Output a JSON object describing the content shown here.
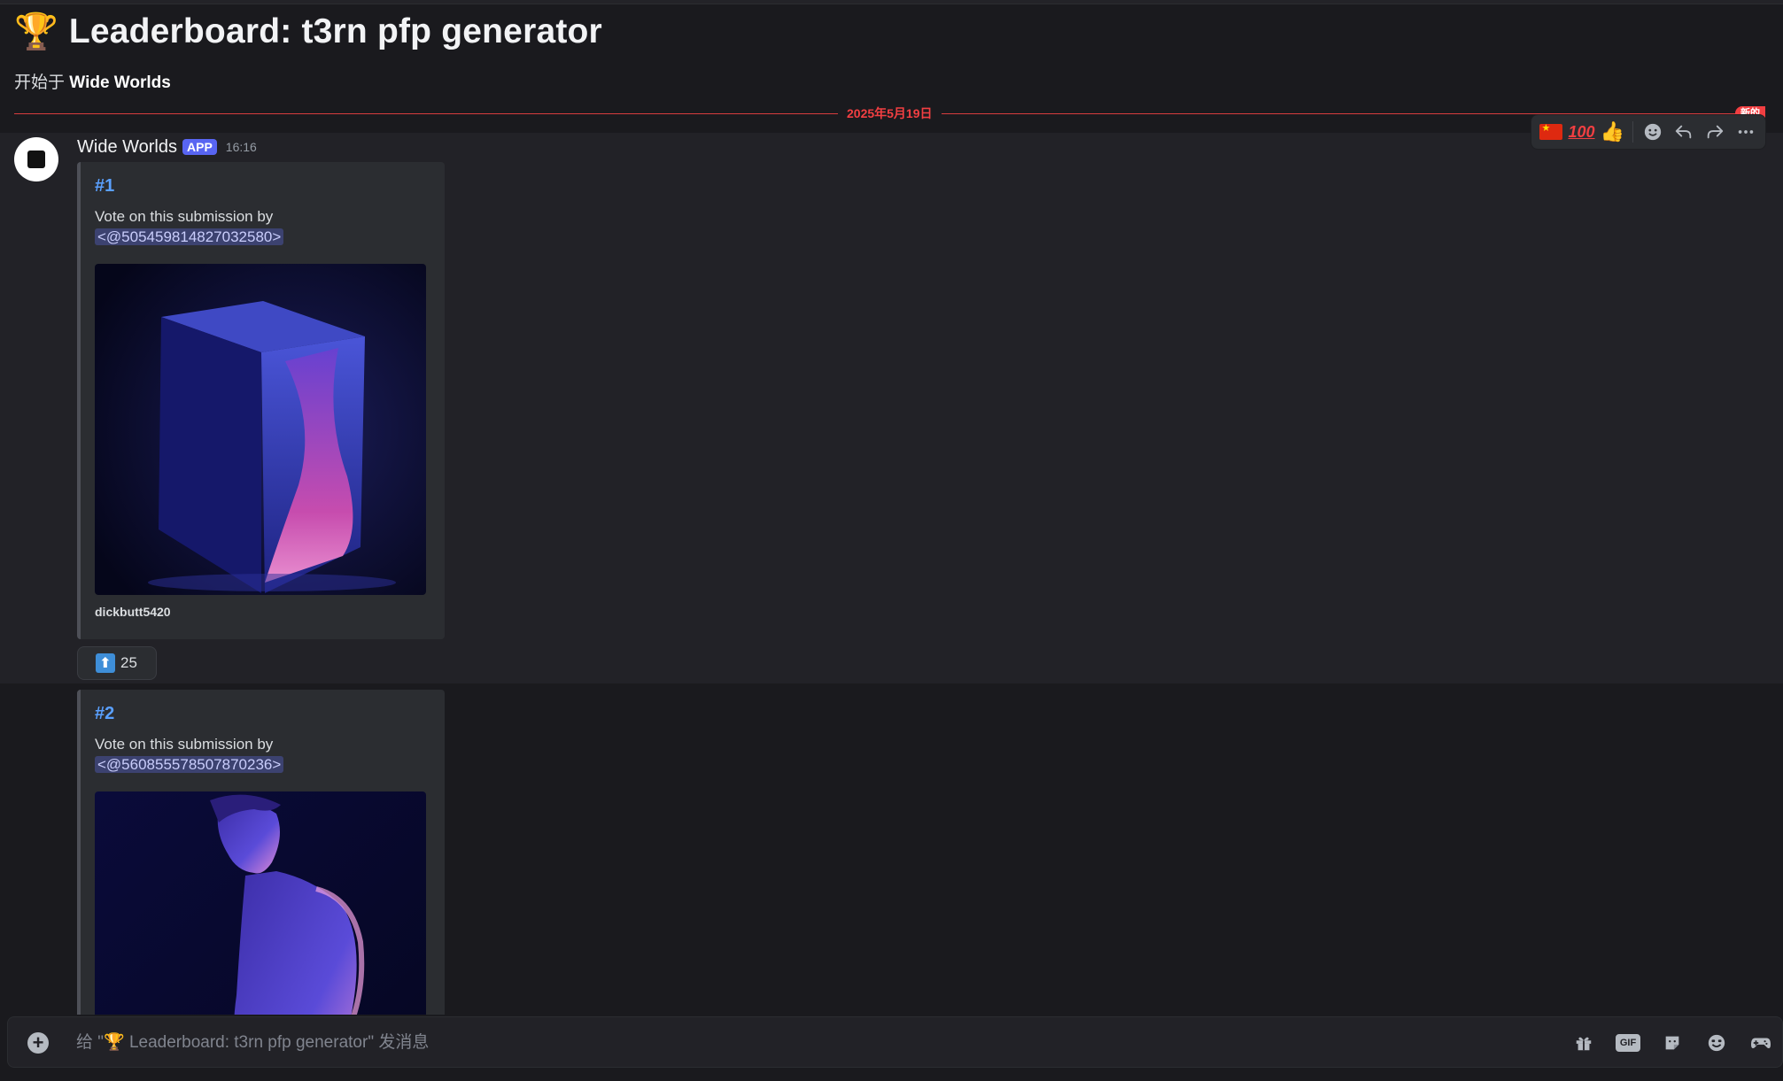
{
  "channel": {
    "icon": "trophy-icon",
    "emoji": "🏆",
    "title": "Leaderboard: t3rn pfp generator",
    "subtitle_prefix": "开始于",
    "subtitle_author": "Wide Worlds"
  },
  "divider": {
    "date": "2025年5月19日",
    "new_label": "新的"
  },
  "message": {
    "author": "Wide Worlds",
    "badge": "APP",
    "time": "16:16"
  },
  "action_bar": {
    "items": [
      "flag-china-icon",
      "hundred-icon",
      "thumbs-up-icon",
      "add-reaction-icon",
      "reply-icon",
      "forward-icon",
      "more-icon"
    ],
    "hundred_text": "100",
    "thumbs_emoji": "👍"
  },
  "embeds": [
    {
      "title": "#1",
      "desc": "Vote on this submission by",
      "mention": "<@505459814827032580>",
      "footer": "dickbutt5420"
    },
    {
      "title": "#2",
      "desc": "Vote on this submission by",
      "mention": "<@560855578507870236>",
      "footer": ""
    }
  ],
  "reaction": {
    "icon": "up-arrow-icon",
    "arrow": "⬆",
    "count": "25"
  },
  "composer": {
    "placeholder": "给 \"🏆 Leaderboard: t3rn pfp generator\" 发消息",
    "icons": [
      "gift-icon",
      "gif-icon",
      "sticker-icon",
      "emoji-icon",
      "apps-icon"
    ],
    "gif_label": "GIF"
  },
  "colors": {
    "background": "#1a1a1e",
    "accent": "#5865f2",
    "new_red": "#f23f42",
    "link": "#5aa0ff"
  }
}
